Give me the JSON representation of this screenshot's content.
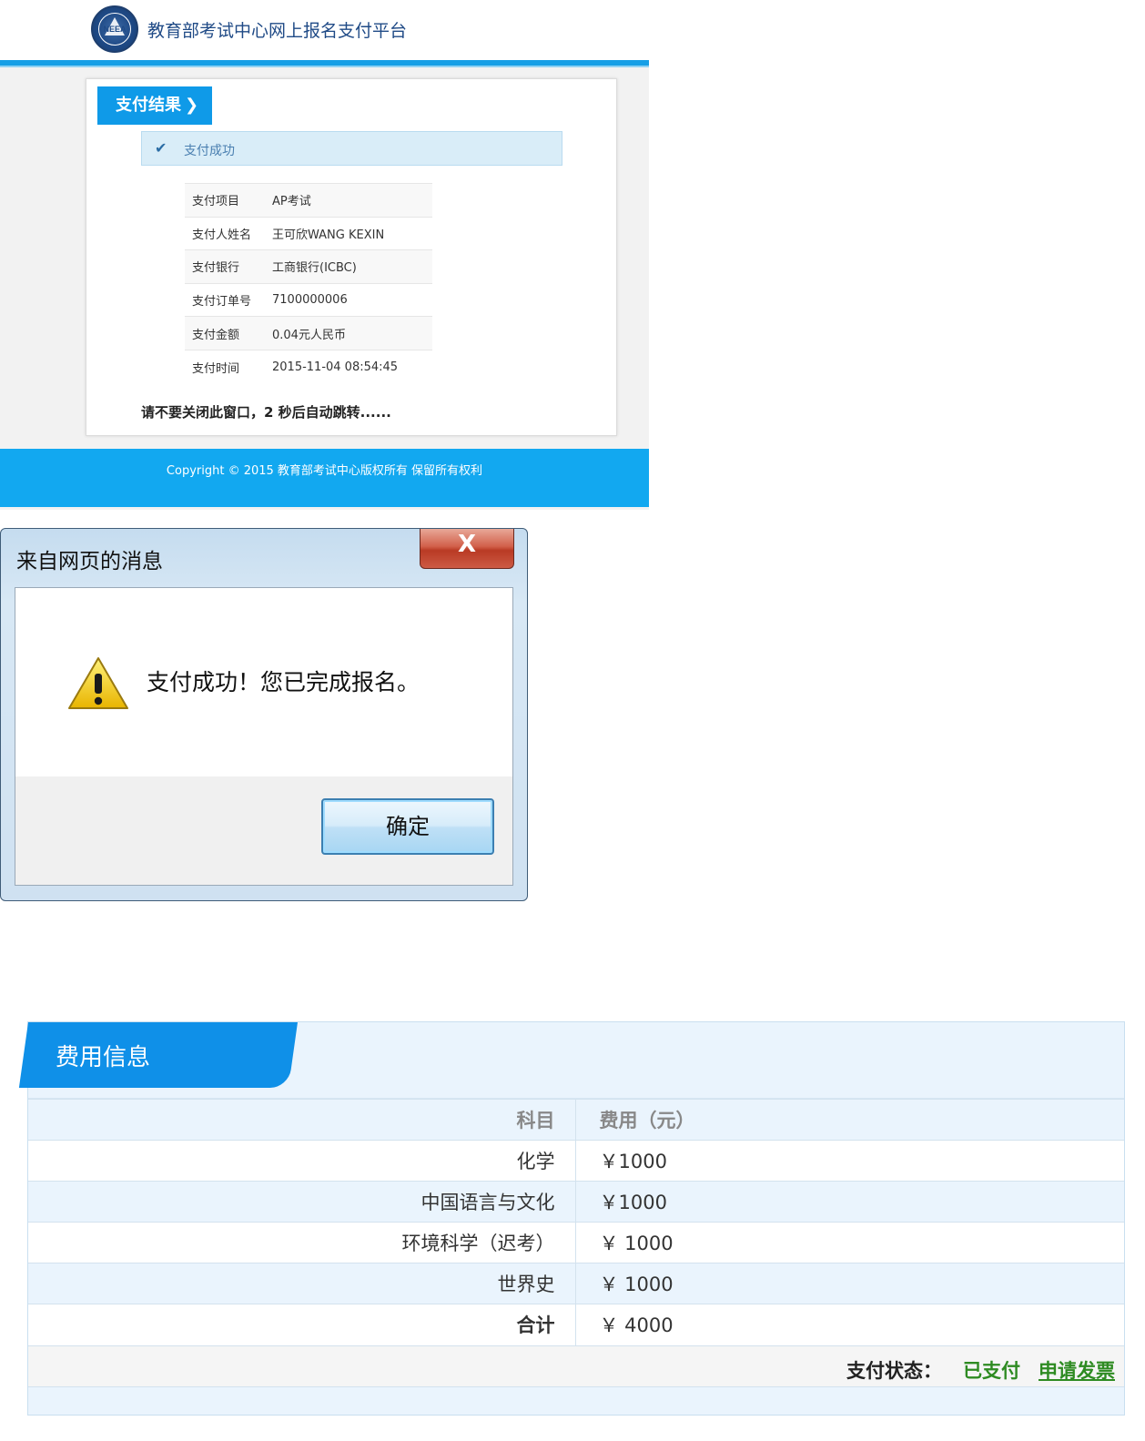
{
  "payment_page": {
    "logo_text": "NEEA",
    "site_title": "教育部考试中心网上报名支付平台",
    "result_tab": "支付结果",
    "success_text": "支付成功",
    "details": [
      {
        "label": "支付项目",
        "value": "AP考试"
      },
      {
        "label": "支付人姓名",
        "value": "王可欣WANG KEXIN"
      },
      {
        "label": "支付银行",
        "value": "工商银行(ICBC)"
      },
      {
        "label": "支付订单号",
        "value": "7100000006"
      },
      {
        "label": "支付金额",
        "value": "0.04元人民币"
      },
      {
        "label": "支付时间",
        "value": "2015-11-04 08:54:45"
      }
    ],
    "redirect_note": "请不要关闭此窗口，2 秒后自动跳转......",
    "footer": "Copyright © 2015 教育部考试中心版权所有 保留所有权利"
  },
  "dialog": {
    "title": "来自网页的消息",
    "close_label": "X",
    "message": "支付成功！您已完成报名。",
    "ok_label": "确定"
  },
  "fee_info": {
    "title": "费用信息",
    "col_subject": "科目",
    "col_fee": "费用（元）",
    "rows": [
      {
        "subject": "化学",
        "fee": "￥1000"
      },
      {
        "subject": "中国语言与文化",
        "fee": "￥1000"
      },
      {
        "subject": "环境科学（迟考）",
        "fee": "￥ 1000"
      },
      {
        "subject": "世界史",
        "fee": "￥ 1000"
      }
    ],
    "total_label": "合计",
    "total_fee": "￥ 4000",
    "status_label": "支付状态：",
    "status_value": "已支付",
    "invoice_link": "申请发票"
  },
  "colors": {
    "brand_blue": "#0f9ae8",
    "success_green": "#2e8b22",
    "footer_blue": "#12a8f0"
  }
}
